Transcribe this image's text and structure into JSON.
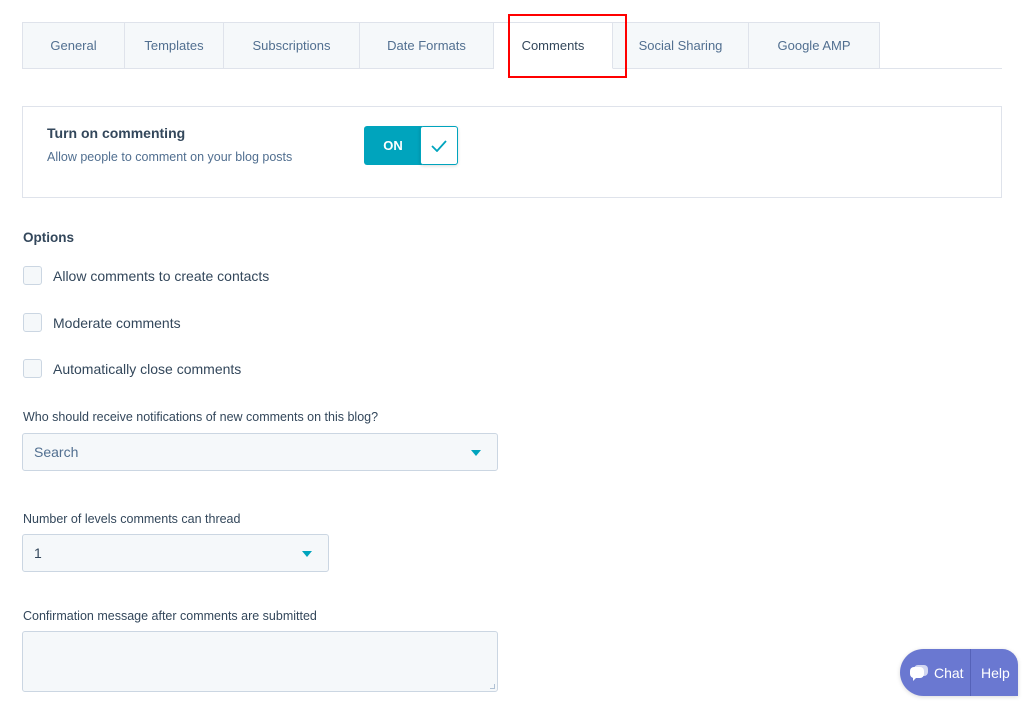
{
  "tabs": {
    "items": [
      {
        "label": "General"
      },
      {
        "label": "Templates"
      },
      {
        "label": "Subscriptions"
      },
      {
        "label": "Date Formats"
      },
      {
        "label": "Comments"
      },
      {
        "label": "Social Sharing"
      },
      {
        "label": "Google AMP"
      }
    ],
    "active": "Comments"
  },
  "commenting": {
    "title": "Turn on commenting",
    "description": "Allow people to comment on your blog posts",
    "toggle_label": "ON",
    "enabled": true
  },
  "options": {
    "title": "Options",
    "items": [
      {
        "label": "Allow comments to create contacts",
        "checked": false
      },
      {
        "label": "Moderate comments",
        "checked": false
      },
      {
        "label": "Automatically close comments",
        "checked": false
      }
    ]
  },
  "notifications": {
    "label": "Who should receive notifications of new comments on this blog?",
    "placeholder": "Search"
  },
  "thread_levels": {
    "label": "Number of levels comments can thread",
    "value": "1"
  },
  "confirmation": {
    "label": "Confirmation message after comments are submitted",
    "value": ""
  },
  "chat_widget": {
    "chat_label": "Chat",
    "help_label": "Help"
  },
  "colors": {
    "accent": "#00a4bd",
    "highlight": "#ff0000",
    "chat": "#6a78d1"
  }
}
